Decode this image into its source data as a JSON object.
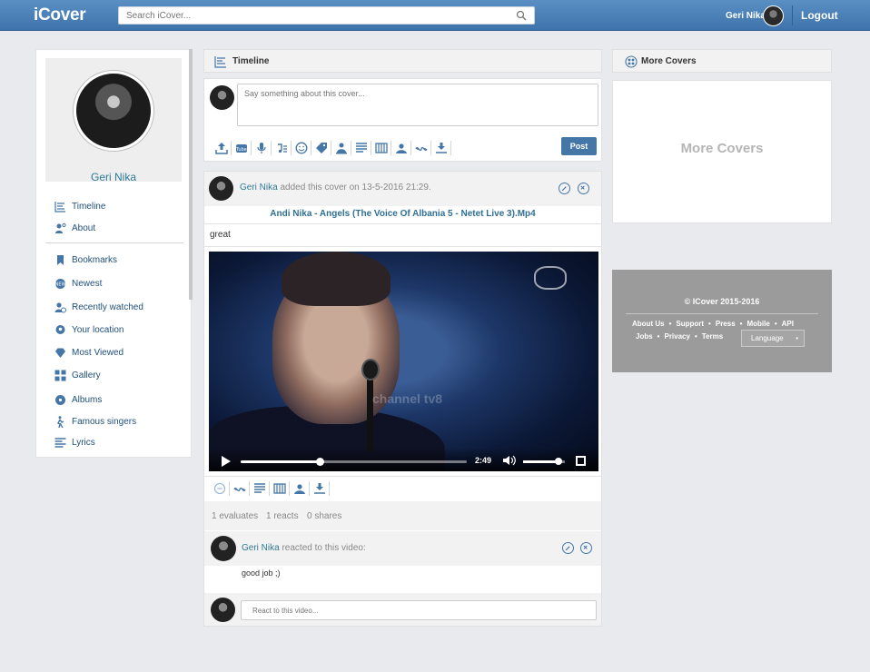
{
  "app": {
    "logo": "iCover"
  },
  "search": {
    "placeholder": "Search iCover...",
    "icon": "search-icon"
  },
  "header": {
    "user_name": "Geri Nika",
    "logout": "Logout"
  },
  "profile": {
    "name": "Geri Nika"
  },
  "sidebar": {
    "items": [
      {
        "label": "Timeline",
        "icon": "timeline-icon"
      },
      {
        "label": "About",
        "icon": "about-icon"
      },
      {
        "label": "Bookmarks",
        "icon": "bookmark-icon"
      },
      {
        "label": "Newest",
        "icon": "newest-icon"
      },
      {
        "label": "Recently watched",
        "icon": "recent-icon"
      },
      {
        "label": "Your location",
        "icon": "location-icon"
      },
      {
        "label": "Most Viewed",
        "icon": "diamond-icon"
      },
      {
        "label": "Gallery",
        "icon": "gallery-icon"
      },
      {
        "label": "Albums",
        "icon": "album-icon"
      },
      {
        "label": "Famous singers",
        "icon": "singer-icon"
      },
      {
        "label": "Lyrics",
        "icon": "lyrics-icon"
      }
    ]
  },
  "timeline": {
    "title": "Timeline",
    "composer_placeholder": "Say something about this cover...",
    "post_button": "Post"
  },
  "post": {
    "author": "Geri Nika",
    "action_text": " added this cover on 13-5-2016 21:29.",
    "title": "Andi Nika - Angels (The Voice Of Albania 5 - Netet Live 3).Mp4",
    "text": "great",
    "video": {
      "time": "2:49",
      "progress": 0.35,
      "volume": 0.85,
      "watermark": "channel tv8"
    },
    "stats": {
      "evaluates": "1 evaluates",
      "reacts": "1 reacts",
      "shares": "0 shares"
    }
  },
  "comment": {
    "author": "Geri Nika",
    "action_text": " reacted to this video:",
    "text": "good job ;)",
    "reply_placeholder": "React to this video..."
  },
  "more_covers": {
    "title": "More Covers",
    "body": "More Covers"
  },
  "footer": {
    "copyright": "© ICover 2015-2016",
    "links_row1": [
      "About Us",
      "Support",
      "Press",
      "Mobile",
      "API"
    ],
    "links_row2": [
      "Jobs",
      "Privacy",
      "Terms"
    ],
    "language": "Language"
  },
  "colors": {
    "brand": "#4576a8",
    "link": "#2f7a93",
    "nav": "#1f4f7a",
    "footer_bg": "#9b9b9b"
  }
}
